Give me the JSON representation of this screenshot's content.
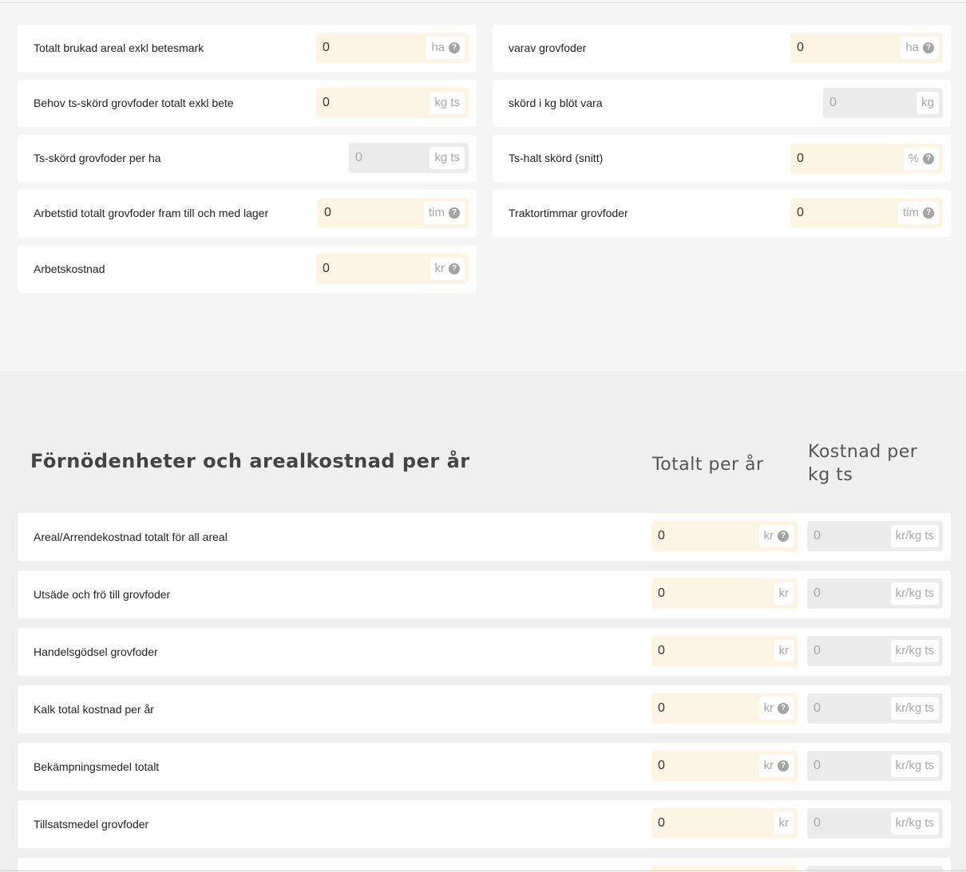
{
  "top_fields": {
    "left": [
      {
        "label": "Totalt brukad areal exkl betesmark",
        "value": "0",
        "unit": "ha",
        "help": true,
        "readonly": false
      },
      {
        "label": "Behov ts-skörd grovfoder totalt exkl bete",
        "value": "0",
        "unit": "kg ts",
        "help": false,
        "readonly": false
      },
      {
        "label": "Ts-skörd grovfoder per ha",
        "value": "0",
        "unit": "kg ts",
        "help": false,
        "readonly": true
      },
      {
        "label": "Arbetstid totalt grovfoder fram till och med lager",
        "value": "0",
        "unit": "tim",
        "help": true,
        "readonly": false
      },
      {
        "label": "Arbetskostnad",
        "value": "0",
        "unit": "kr",
        "help": true,
        "readonly": false
      }
    ],
    "right": [
      {
        "label": "varav grovfoder",
        "value": "0",
        "unit": "ha",
        "help": true,
        "readonly": false
      },
      {
        "label": "skörd i kg blöt vara",
        "value": "0",
        "unit": "kg",
        "help": false,
        "readonly": true
      },
      {
        "label": "Ts-halt skörd (snitt)",
        "value": "0",
        "unit": "%",
        "help": true,
        "readonly": false
      },
      {
        "label": "Traktortimmar grovfoder",
        "value": "0",
        "unit": "tim",
        "help": true,
        "readonly": false
      }
    ]
  },
  "costs_section": {
    "title": "Förnödenheter och arealkostnad per år",
    "col_total": "Totalt per år",
    "col_per_kg_line1": "Kostnad per",
    "col_per_kg_line2": "kg ts",
    "rows": [
      {
        "label": "Areal/Arrendekostnad totalt för all areal",
        "total": "0",
        "total_unit": "kr",
        "help": true,
        "per_kg": "0",
        "per_kg_unit": "kr/kg ts"
      },
      {
        "label": "Utsäde och frö till grovfoder",
        "total": "0",
        "total_unit": "kr",
        "help": false,
        "per_kg": "0",
        "per_kg_unit": "kr/kg ts"
      },
      {
        "label": "Handelsgödsel grovfoder",
        "total": "0",
        "total_unit": "kr",
        "help": false,
        "per_kg": "0",
        "per_kg_unit": "kr/kg ts"
      },
      {
        "label": "Kalk total kostnad per år",
        "total": "0",
        "total_unit": "kr",
        "help": true,
        "per_kg": "0",
        "per_kg_unit": "kr/kg ts"
      },
      {
        "label": "Bekämpningsmedel totalt",
        "total": "0",
        "total_unit": "kr",
        "help": true,
        "per_kg": "0",
        "per_kg_unit": "kr/kg ts"
      },
      {
        "label": "Tillsatsmedel grovfoder",
        "total": "0",
        "total_unit": "kr",
        "help": false,
        "per_kg": "0",
        "per_kg_unit": "kr/kg ts"
      }
    ]
  },
  "colors": {
    "editable_bg": "#fcf5e3",
    "readonly_bg": "#ebebeb"
  },
  "icons": {
    "help": "question-circle-icon"
  }
}
